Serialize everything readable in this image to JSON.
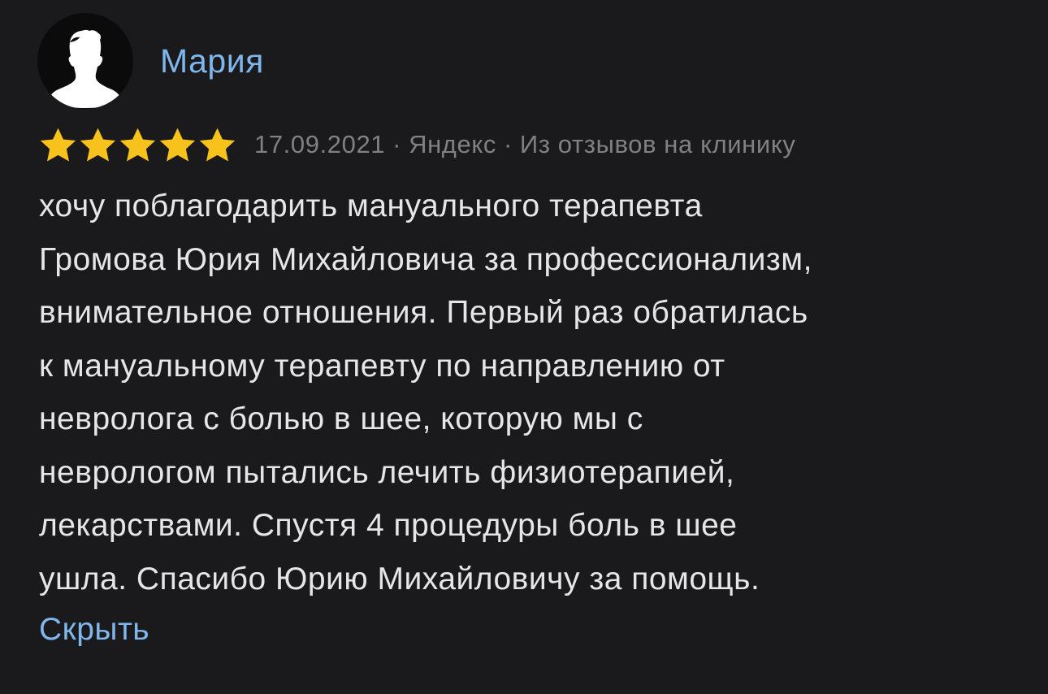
{
  "review": {
    "author": "Мария",
    "rating": 5,
    "rating_max": 5,
    "date": "17.09.2021",
    "separator": "·",
    "source": "Яндекс",
    "origin": "Из отзывов на клинику",
    "text_lines": [
      "хочу поблагодарить мануального терапевта",
      "Громова Юрия Михайловича за профессионализм,",
      "внимательное отношения. Первый раз обратилась",
      "к мануальному терапевту по направлению от",
      "невролога с болью в шее, которую мы с",
      "неврологом пытались лечить физиотерапией,",
      "лекарствами. Спустя 4 процедуры боль в шее",
      "ушла. Спасибо Юрию Михайловичу за помощь."
    ],
    "collapse_label": "Скрыть"
  },
  "icons": {
    "avatar": "person-silhouette-icon",
    "star": "star-icon"
  },
  "colors": {
    "background": "#1a191b",
    "link": "#7fb7ec",
    "star": "#f6c21b",
    "meta_text": "#808085",
    "body_text": "#e6e6e6",
    "avatar_bg": "#0b0b0c"
  }
}
